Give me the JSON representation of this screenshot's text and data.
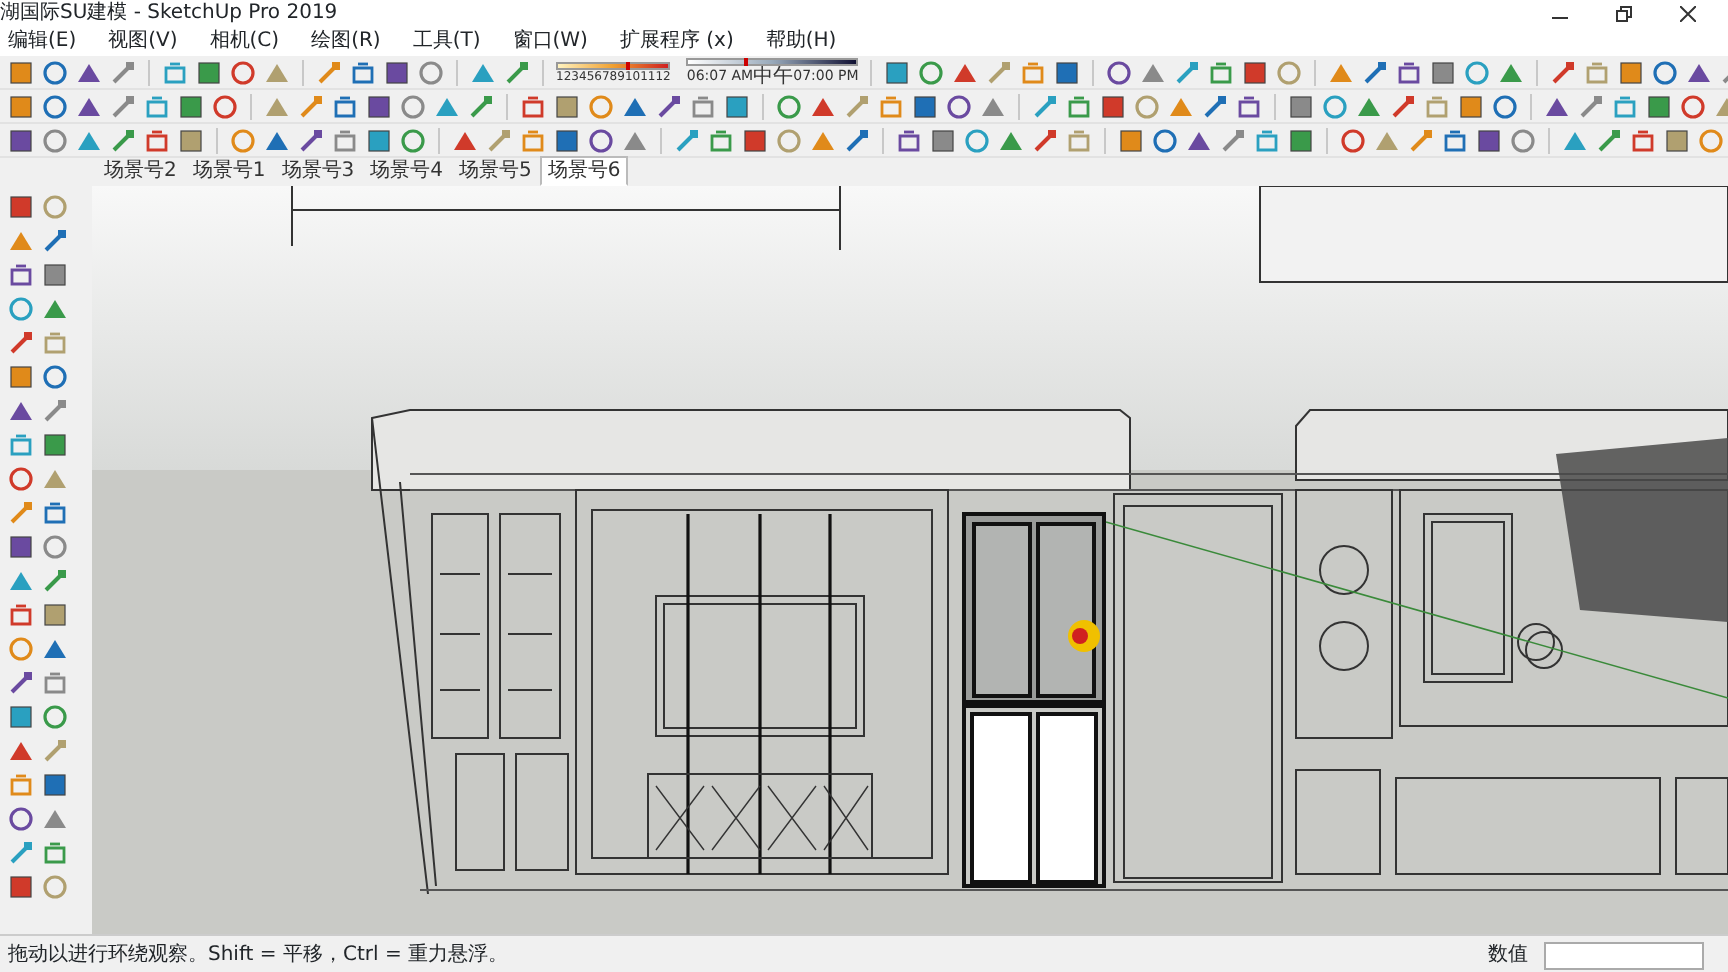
{
  "window": {
    "title": "湖国际SU建模 - SketchUp Pro 2019"
  },
  "menu": [
    "编辑(E)",
    "视图(V)",
    "相机(C)",
    "绘图(R)",
    "工具(T)",
    "窗口(W)",
    "扩展程序 (x)",
    "帮助(H)"
  ],
  "shadow_settings": {
    "month_slider": {
      "labels": [
        "1",
        "2",
        "3",
        "4",
        "5",
        "6",
        "7",
        "8",
        "9",
        "10",
        "11",
        "12"
      ],
      "level": 0.62
    },
    "time_slider": {
      "labels": [
        "06:07 AM",
        "中午",
        "07:00 PM"
      ],
      "level": 0.33
    }
  },
  "scene_tabs": [
    {
      "label": "场景号2",
      "selected": false
    },
    {
      "label": "场景号1",
      "selected": false
    },
    {
      "label": "场景号3",
      "selected": false
    },
    {
      "label": "场景号4",
      "selected": false
    },
    {
      "label": "场景号5",
      "selected": false
    },
    {
      "label": "场景号6",
      "selected": true
    }
  ],
  "status_bar": {
    "hint": "拖动以进行环绕观察。Shift = 平移，Ctrl = 重力悬浮。",
    "measurements_label": "数值"
  }
}
